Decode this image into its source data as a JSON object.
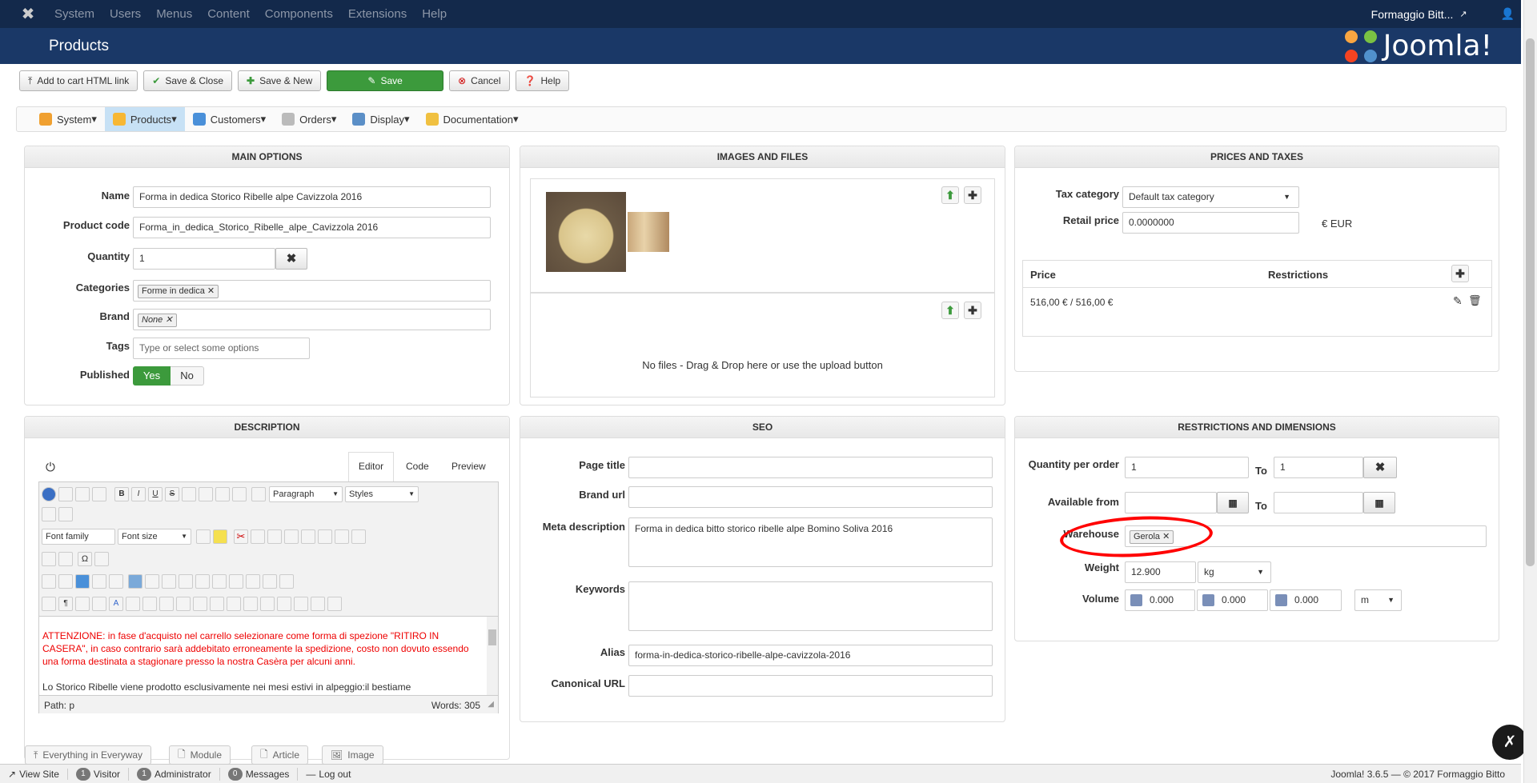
{
  "navbar": {
    "items": [
      "System",
      "Users",
      "Menus",
      "Content",
      "Components",
      "Extensions",
      "Help"
    ],
    "site": "Formaggio Bitt...",
    "user": "👤"
  },
  "header": {
    "title": "Products",
    "brand": "Joomla!"
  },
  "toolbar": {
    "add_to_cart": "Add to cart HTML link",
    "save_close": "Save & Close",
    "save_new": "Save & New",
    "save": "Save",
    "cancel": "Cancel",
    "help": "Help"
  },
  "menubar": {
    "items": [
      "System",
      "Products",
      "Customers",
      "Orders",
      "Display",
      "Documentation"
    ]
  },
  "main_options": {
    "title": "MAIN OPTIONS",
    "name_label": "Name",
    "name_value": "Forma in dedica Storico Ribelle alpe Cavizzola 2016",
    "code_label": "Product code",
    "code_value": "Forma_in_dedica_Storico_Ribelle_alpe_Cavizzola 2016",
    "qty_label": "Quantity",
    "qty_value": "1",
    "cat_label": "Categories",
    "cat_tag": "Forme in dedica",
    "brand_label": "Brand",
    "brand_tag": "None",
    "tags_label": "Tags",
    "tags_placeholder": "Type or select some options",
    "published_label": "Published",
    "yes": "Yes",
    "no": "No"
  },
  "images": {
    "title": "IMAGES AND FILES",
    "nofiles": "No files - Drag & Drop here or use the upload button"
  },
  "prices": {
    "title": "PRICES AND TAXES",
    "tax_label": "Tax category",
    "tax_value": "Default tax category",
    "retail_label": "Retail price",
    "retail_value": "0.0000000",
    "currency": "€ EUR",
    "col_price": "Price",
    "col_restrictions": "Restrictions",
    "row_price": "516,00 € / 516,00 €"
  },
  "description": {
    "title": "DESCRIPTION",
    "tab_editor": "Editor",
    "tab_code": "Code",
    "tab_preview": "Preview",
    "paragraph": "Paragraph",
    "styles": "Styles",
    "font_family": "Font family",
    "font_size": "Font size",
    "text_red": "ATTENZIONE: in fase d'acquisto nel carrello selezionare come forma di spezione \"RITIRO IN CASERA\", in caso contrario sarà addebitato erroneamente la spedizione, costo non dovuto essendo una forma destinata a stagionare presso la nostra Casèra per alcuni anni.",
    "text_black": "Lo Storico Ribelle viene prodotto esclusivamente nei mesi estivi in alpeggio:il bestiame",
    "path": "Path: p",
    "words": "Words: 305",
    "buttons": [
      "Everything in Everyway",
      "Module",
      "Article",
      "Image"
    ]
  },
  "seo": {
    "title": "SEO",
    "page_title_label": "Page title",
    "brand_url_label": "Brand url",
    "meta_label": "Meta description",
    "meta_value": "Forma in dedica bitto storico ribelle alpe Bomino Soliva 2016",
    "keywords_label": "Keywords",
    "alias_label": "Alias",
    "alias_value": "forma-in-dedica-storico-ribelle-alpe-cavizzola-2016",
    "canonical_label": "Canonical URL"
  },
  "restrictions": {
    "title": "RESTRICTIONS AND DIMENSIONS",
    "qpo_label": "Quantity per order",
    "qpo_from": "1",
    "to": "To",
    "qpo_to": "1",
    "avail_label": "Available from",
    "warehouse_label": "Warehouse",
    "warehouse_tag": "Gerola",
    "weight_label": "Weight",
    "weight_value": "12.900",
    "weight_unit": "kg",
    "volume_label": "Volume",
    "vol1": "0.000",
    "vol2": "0.000",
    "vol3": "0.000",
    "vol_unit": "m"
  },
  "bottombar": {
    "view_site": "View Site",
    "visitor_count": "1",
    "visitor": "Visitor",
    "admin_count": "1",
    "admin": "Administrator",
    "msg_count": "0",
    "messages": "Messages",
    "logout": "Log out",
    "version": "Joomla! 3.6.5 — © 2017 Formaggio Bitto"
  }
}
